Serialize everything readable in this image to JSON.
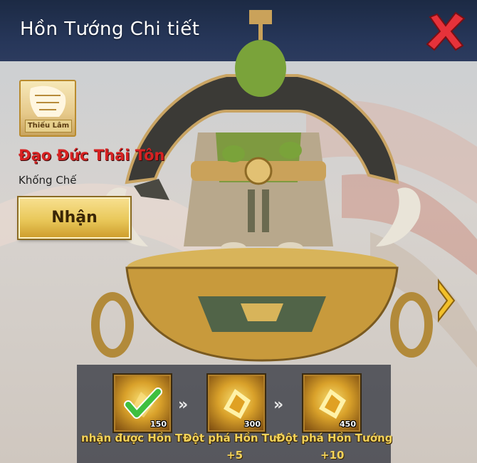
{
  "header": {
    "title": "Hồn Tướng Chi tiết"
  },
  "hero": {
    "portrait_tag": "Thiếu Lâm",
    "name": "Đạo Đức Thái Tôn",
    "class": "Khống Chế",
    "claim_label": "Nhận"
  },
  "progress": {
    "steps": [
      {
        "label": "nhận được Hồn Tư",
        "count": "150",
        "done": true
      },
      {
        "label": "Đột phá Hồn Tướ",
        "sub": "+5",
        "count": "300",
        "done": false
      },
      {
        "label": "Đột phá Hồn Tướng",
        "sub": "+10",
        "count": "450",
        "done": false
      }
    ],
    "separator": "››"
  },
  "colors": {
    "header_bg": "#27375a",
    "name_red": "#d72222",
    "gold": "#e9c85a",
    "check_green": "#3fbf3f"
  },
  "icons": {
    "close": "close-icon",
    "next": "chevron-right-icon",
    "check": "check-icon",
    "item": "soul-shard-icon"
  }
}
